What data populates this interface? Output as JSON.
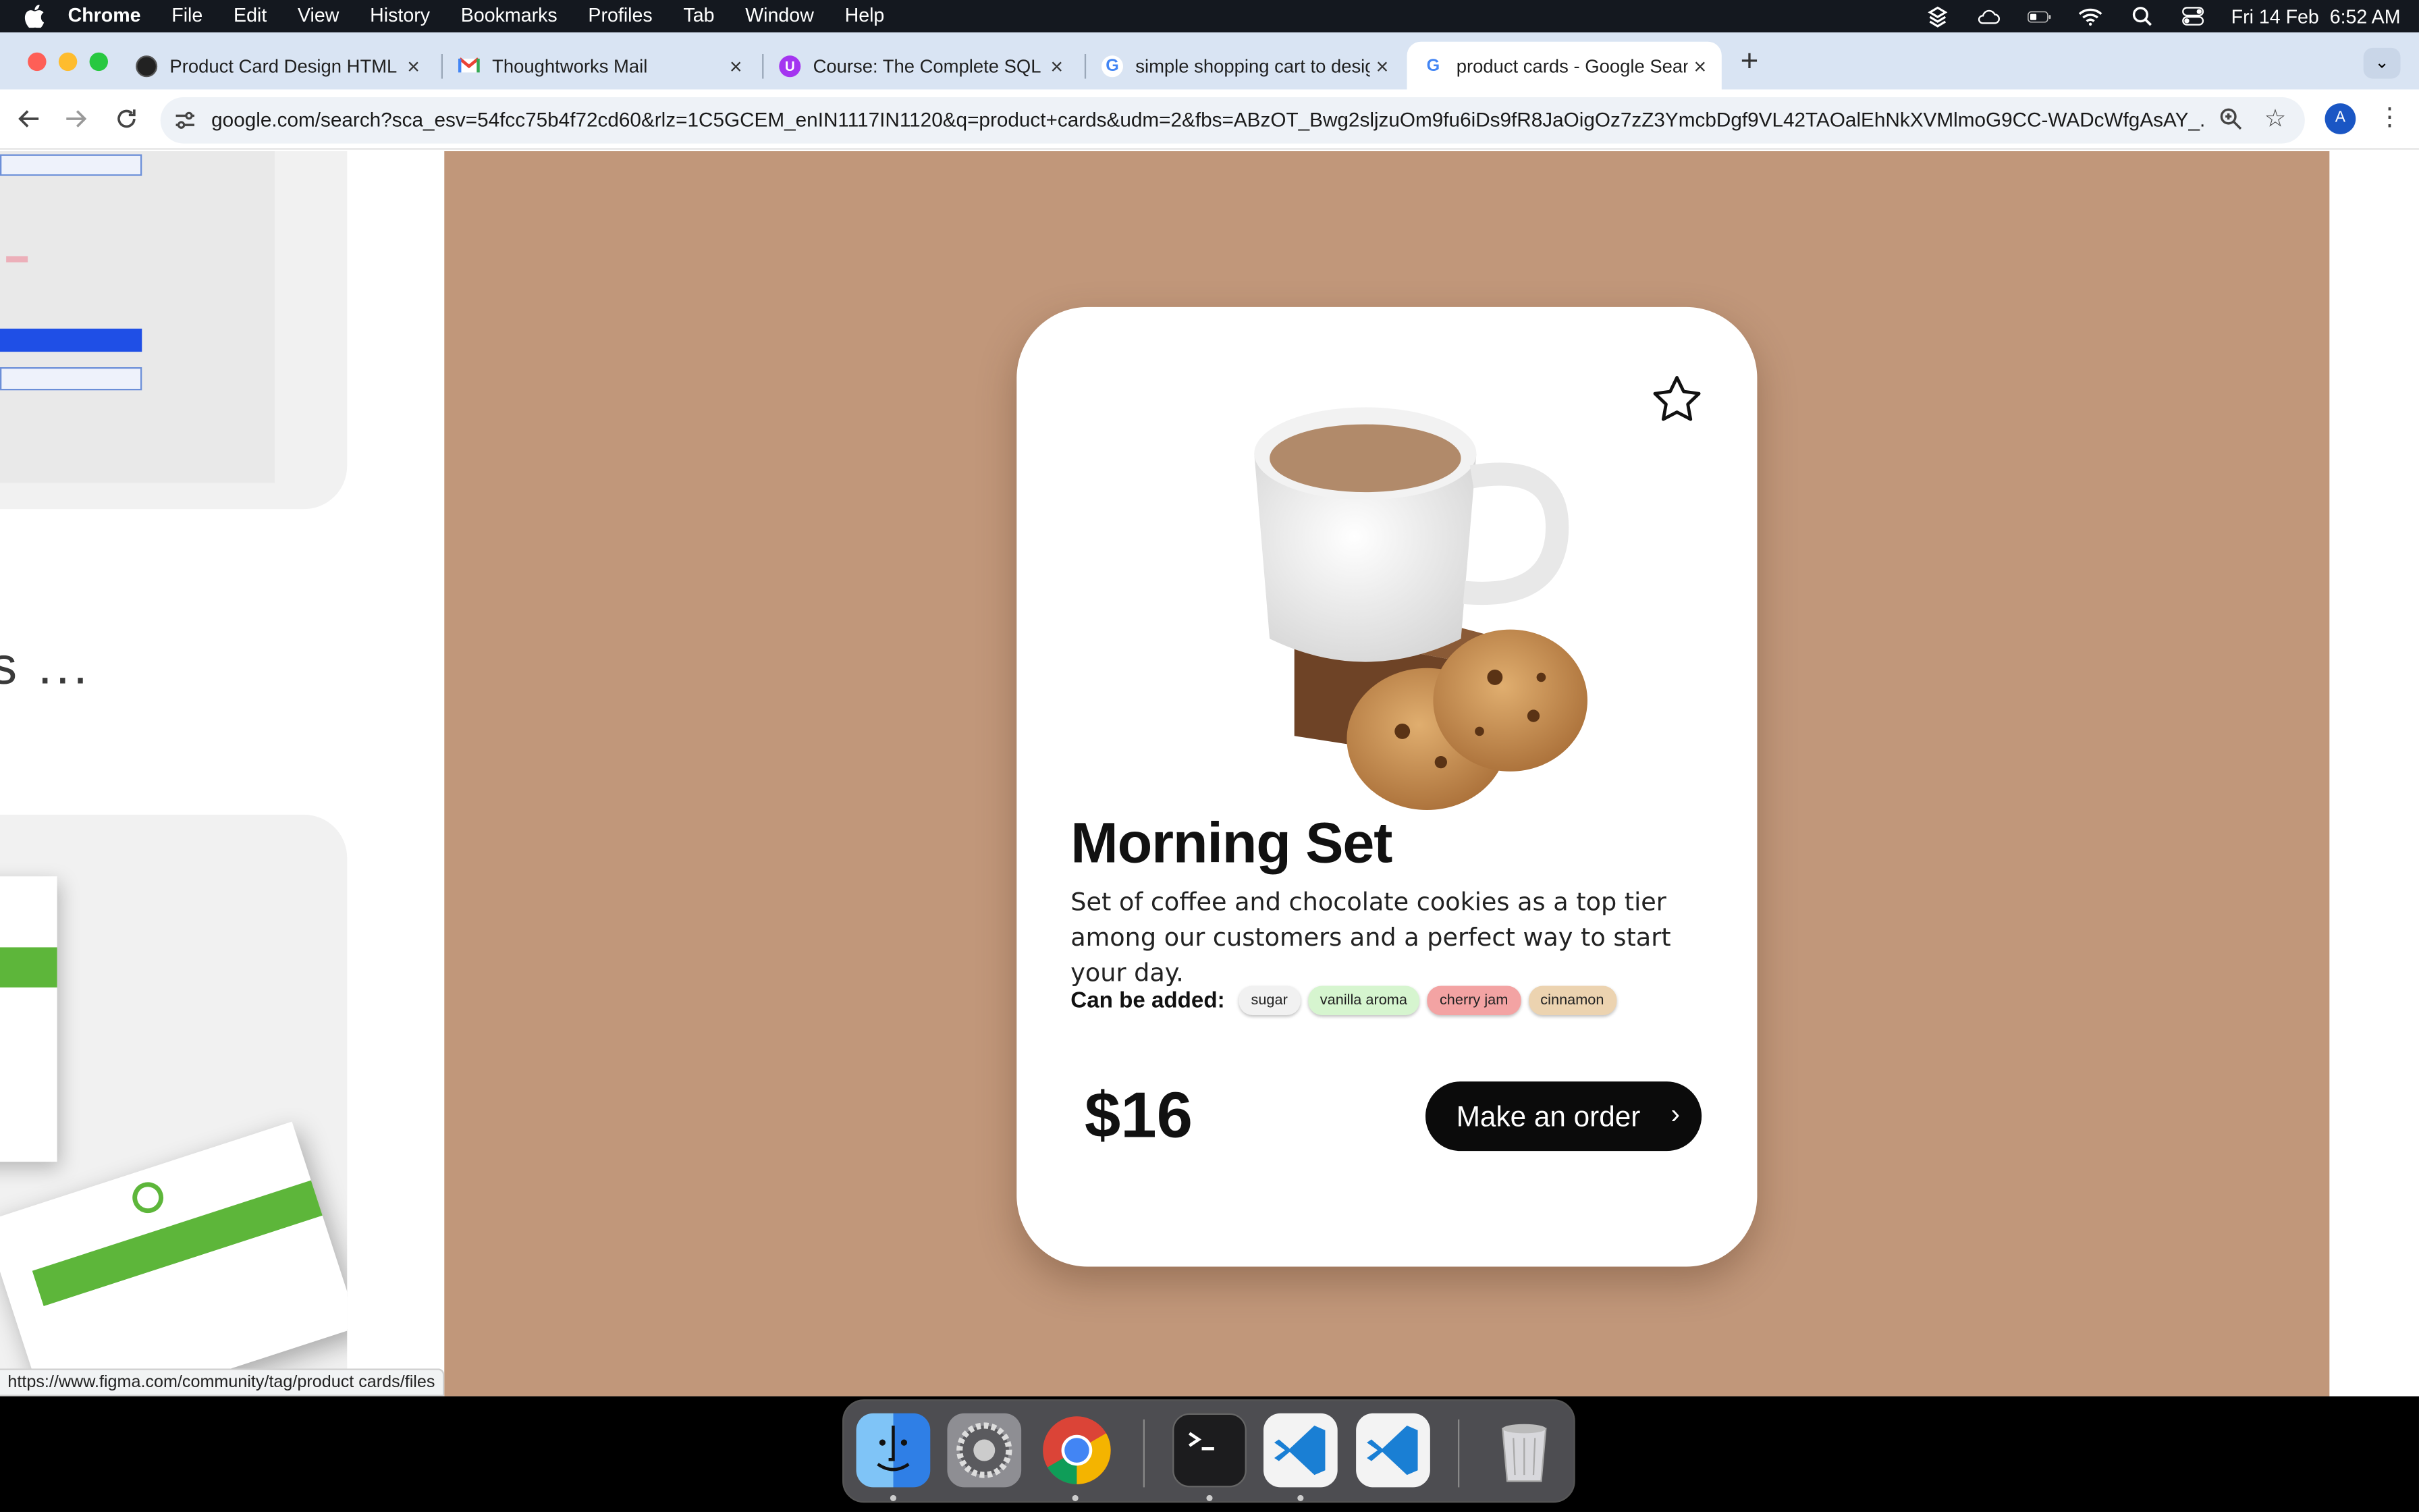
{
  "menubar": {
    "app": "Chrome",
    "items": [
      "File",
      "Edit",
      "View",
      "History",
      "Bookmarks",
      "Profiles",
      "Tab",
      "Window",
      "Help"
    ],
    "datetime": "Fri 14 Feb  6:52 AM"
  },
  "tabs": [
    {
      "title": "Product Card Design HTML",
      "favicon": "codepen-icon"
    },
    {
      "title": "Thoughtworks Mail",
      "favicon": "gmail-icon"
    },
    {
      "title": "Course: The Complete SQL B",
      "favicon": "udemy-icon"
    },
    {
      "title": "simple shopping cart to desig",
      "favicon": "google-icon"
    },
    {
      "title": "product cards - Google Searc",
      "favicon": "google-icon",
      "active": true
    }
  ],
  "toolbar": {
    "url": "google.com/search?sca_esv=54fcc75b4f72cd60&rlz=1C5GCEM_enIN1117IN1120&q=product+cards&udm=2&fbs=ABzOT_Bwg2sljzuOm9fu6iDs9fR8JaOigOz7zZ3YmcbDgf9VL42TAOalEhNkXVMlmoG9CC-WADcWfgAsAY_...",
    "profile_initial": "A"
  },
  "left_panel": {
    "truncated_title": "s ..."
  },
  "product_card": {
    "name": "Morning Set",
    "description": "Set of coffee and chocolate cookies as a top tier among our customers and a perfect way to start your day.",
    "addons_label": "Can be added:",
    "addons": [
      {
        "label": "sugar",
        "color": "#f1f1f1"
      },
      {
        "label": "vanilla aroma",
        "color": "#d6f5cf"
      },
      {
        "label": "cherry jam",
        "color": "#f3a3a3"
      },
      {
        "label": "cinnamon",
        "color": "#ecd3b0"
      }
    ],
    "price": "$16",
    "order_button": "Make an order",
    "background": "#c1977a"
  },
  "statusbar": {
    "link": "https://www.figma.com/community/tag/product cards/files"
  },
  "dock": {
    "apps": [
      "finder-icon",
      "system-settings-icon",
      "chrome-icon",
      "terminal-icon",
      "vscode-icon",
      "vscode-icon",
      "trash-icon"
    ]
  }
}
